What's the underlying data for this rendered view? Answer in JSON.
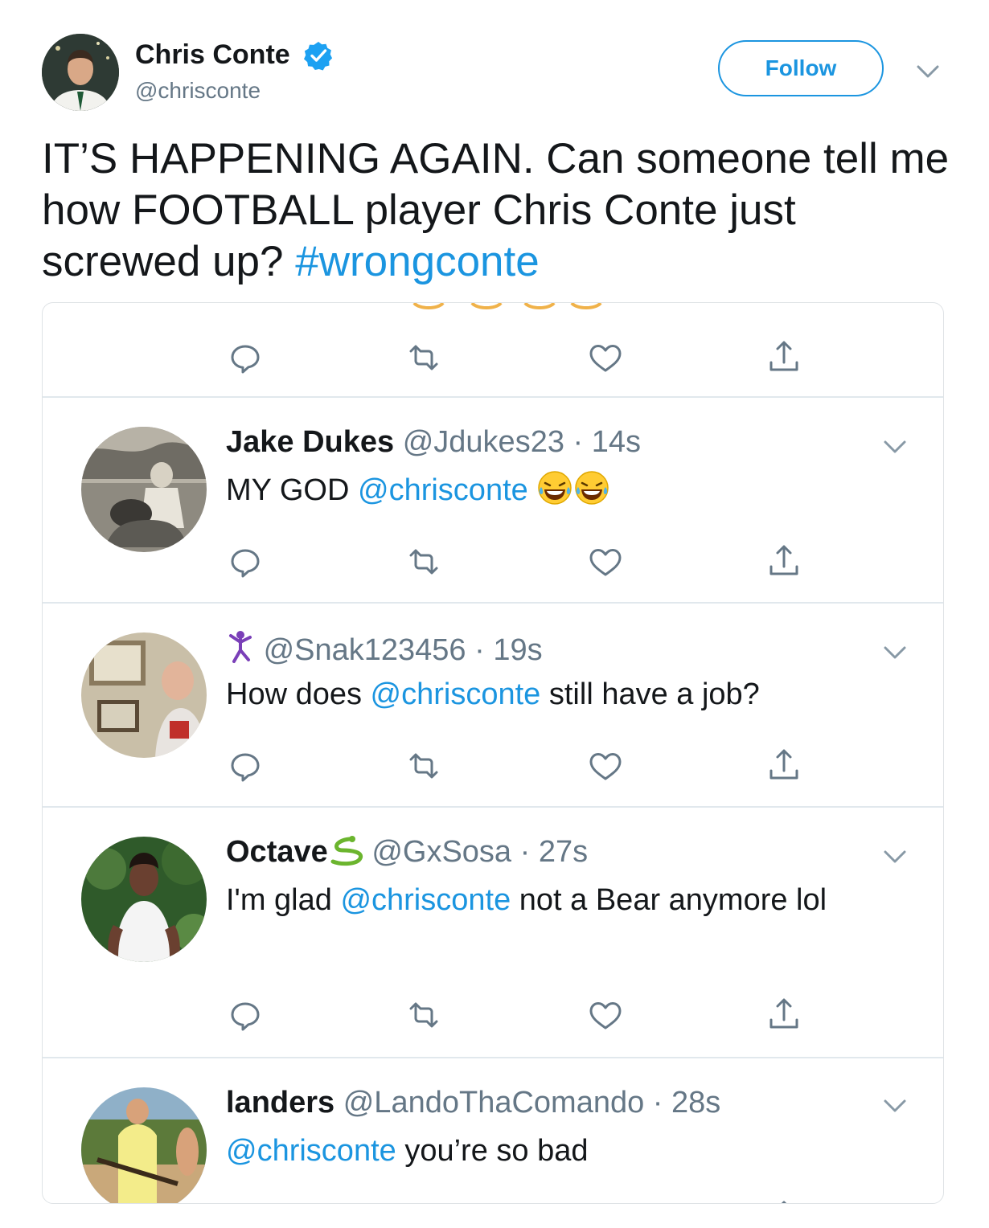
{
  "author": {
    "name": "Chris Conte",
    "handle": "@chrisconte",
    "follow_label": "Follow"
  },
  "tweet": {
    "text": "IT’S HAPPENING AGAIN. Can someone tell me how FOOTBALL player Chris Conte just screwed up? ",
    "hashtag": "#wrongconte"
  },
  "replies": [
    {
      "name": "Jake Dukes",
      "handle": "@Jdukes23",
      "time": "14s",
      "text_before": "MY GOD ",
      "mention": "@chrisconte",
      "text_after": ""
    },
    {
      "name": "",
      "handle": "@Snak123456",
      "time": "19s",
      "text_before": "How does ",
      "mention": "@chrisconte",
      "text_after": " still have a job?"
    },
    {
      "name": "Octave",
      "handle": "@GxSosa",
      "time": "27s",
      "text_before": "I'm glad ",
      "mention": "@chrisconte",
      "text_after": " not a Bear anymore lol"
    },
    {
      "name": "landers",
      "handle": "@LandoThaComando",
      "time": "28s",
      "text_before": "",
      "mention": "@chrisconte",
      "text_after": " you’re so bad"
    }
  ],
  "icons": {
    "verified": "verified-badge-icon",
    "reply": "reply-icon",
    "retweet": "retweet-icon",
    "like": "heart-icon",
    "share": "share-icon",
    "caret": "chevron-down-icon"
  },
  "colors": {
    "accent": "#1b95e0",
    "muted": "#657786",
    "text": "#14171a"
  }
}
